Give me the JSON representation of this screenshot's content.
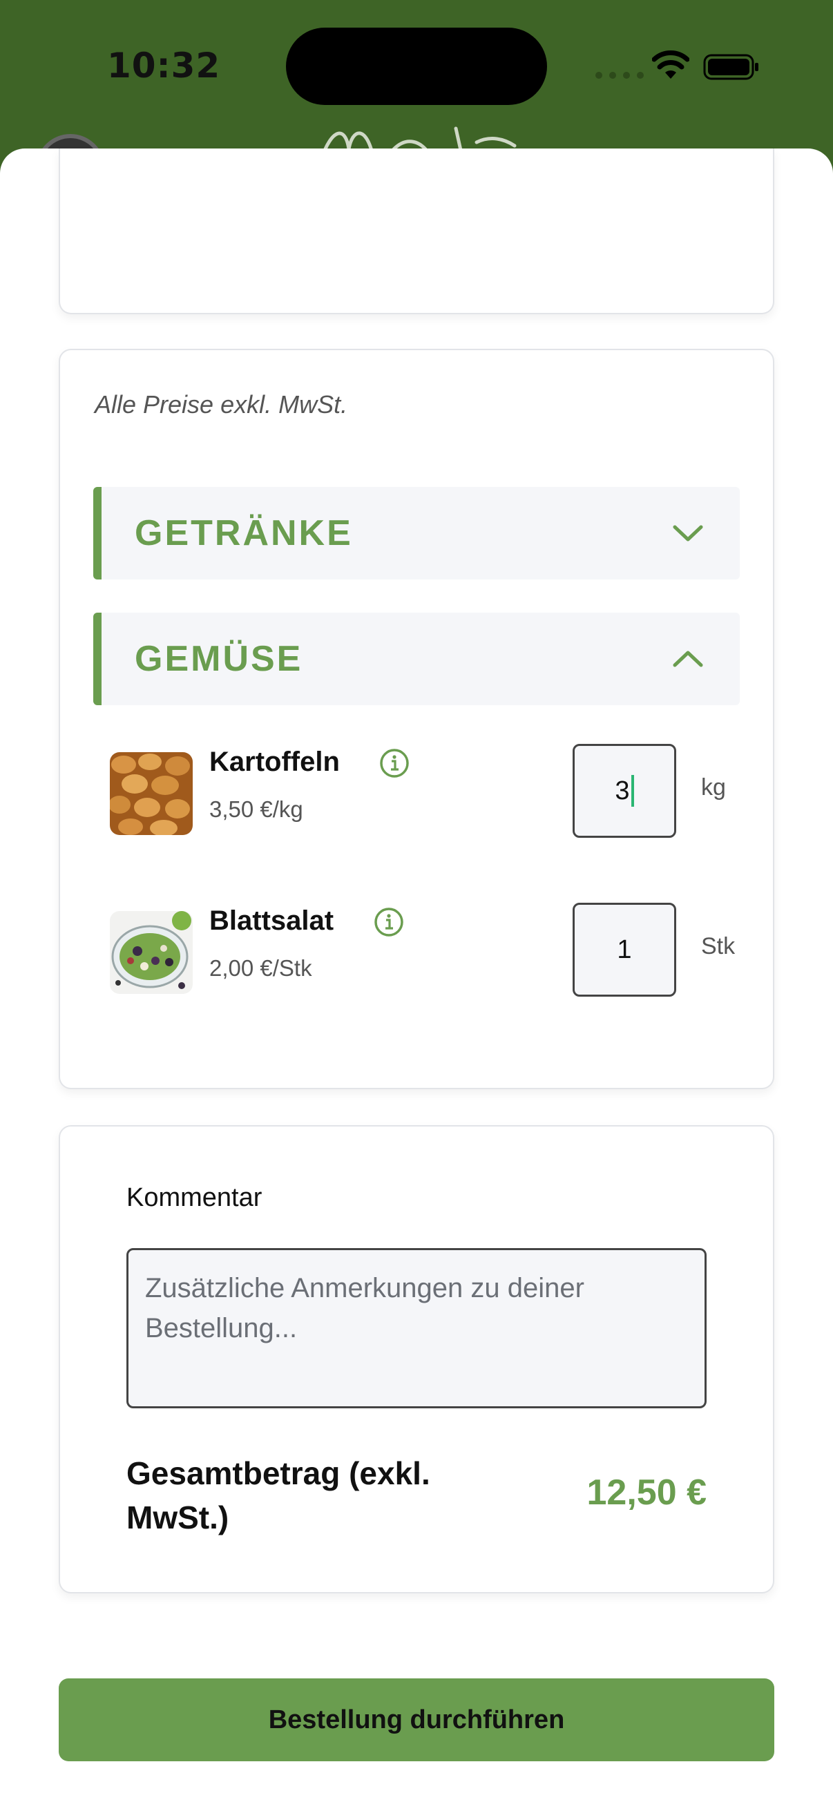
{
  "status_bar": {
    "time": "10:32"
  },
  "colors": {
    "brand_green": "#6a9d4f",
    "header_green": "#3e6426",
    "field_bg": "#f5f6f9"
  },
  "price_note": "Alle Preise exkl. MwSt.",
  "categories": [
    {
      "label": "GETRÄNKE",
      "expanded": false,
      "icon": "chevron-down-icon"
    },
    {
      "label": "GEMÜSE",
      "expanded": true,
      "icon": "chevron-up-icon"
    }
  ],
  "products": [
    {
      "name": "Kartoffeln",
      "price": "3,50 €/kg",
      "quantity": "3",
      "unit": "kg",
      "image": "potatoes-image"
    },
    {
      "name": "Blattsalat",
      "price": "2,00 €/Stk",
      "quantity": "1",
      "unit": "Stk",
      "image": "salad-image"
    }
  ],
  "comment": {
    "label": "Kommentar",
    "placeholder": "Zusätzliche Anmerkungen zu deiner Bestellung...",
    "value": ""
  },
  "total": {
    "label": "Gesamtbetrag (exkl. MwSt.)",
    "value": "12,50 €"
  },
  "submit_label": "Bestellung durchführen"
}
